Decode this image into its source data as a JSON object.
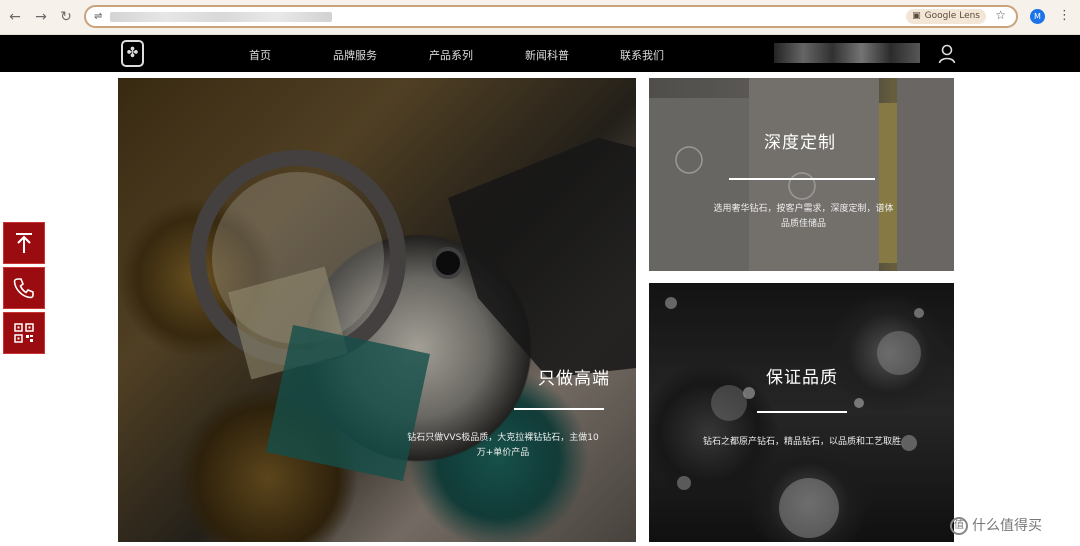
{
  "browser": {
    "back_icon": "arrow-left-icon",
    "forward_icon": "arrow-right-icon",
    "reload_icon": "reload-icon",
    "lens_label": "Google Lens",
    "profile_initial": "M"
  },
  "nav": {
    "items": [
      "首页",
      "品牌服务",
      "产品系列",
      "新闻科普",
      "联系我们"
    ]
  },
  "tiles": {
    "main": {
      "title": "只做高端",
      "desc_line1": "钻石只做VVS极品质，大克拉裸钻钻石，主做10",
      "desc_line2": "万+单价产品"
    },
    "custom": {
      "title": "深度定制",
      "desc_line1": "选用奢华钻石，按客户需求，深度定制，谱体",
      "desc_line2": "品质佳储品"
    },
    "quality": {
      "title": "保证品质",
      "desc_line1": "钻石之都原产钻石，精品钻石，以品质和工艺取胜"
    }
  },
  "side": {
    "top_icon": "arrow-to-top-icon",
    "phone_icon": "phone-icon",
    "qr_icon": "qr-code-icon"
  },
  "watermark": {
    "text": "什么值得买"
  },
  "colors": {
    "brand_red": "#9b0c10",
    "header_black": "#000000"
  }
}
